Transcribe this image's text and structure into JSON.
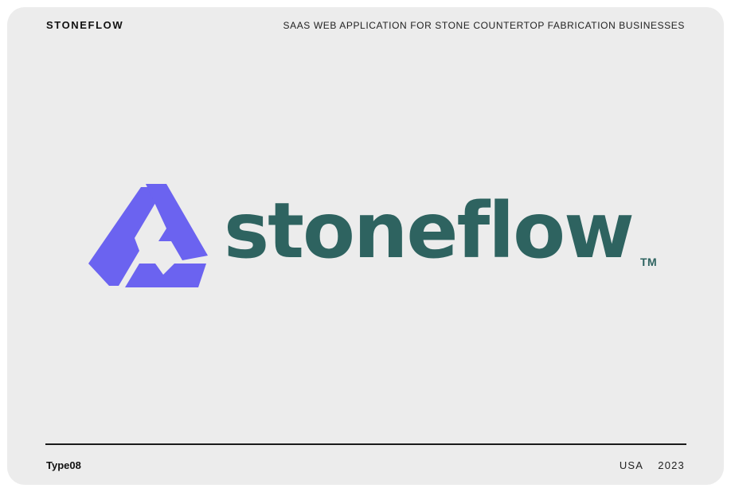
{
  "header": {
    "brand": "STONEFLOW",
    "tagline": "SAAS WEB APPLICATION FOR STONE COUNTERTOP FABRICATION BUSINESSES"
  },
  "logo": {
    "mark_icon": "stoneflow-triangle-mark-icon",
    "wordmark": "stoneflow",
    "trademark": "TM",
    "mark_color": "#6b63f0",
    "wordmark_color": "#2e6360"
  },
  "footer": {
    "studio": "Type08",
    "country": "USA",
    "year": "2023"
  },
  "colors": {
    "background": "#ececec",
    "text": "#111111"
  }
}
